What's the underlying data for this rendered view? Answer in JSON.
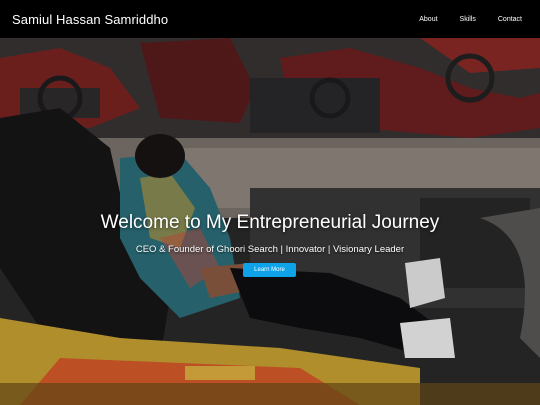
{
  "header": {
    "brand": "Samiul Hassan Samriddho",
    "nav": [
      {
        "label": "About"
      },
      {
        "label": "Skills"
      },
      {
        "label": "Contact"
      }
    ]
  },
  "hero": {
    "title": "Welcome to My Entrepreneurial Journey",
    "subtitle": "CEO & Founder of Ghoori Search | Innovator | Visionary Leader",
    "button_label": "Learn More",
    "button_color": "#0ea2e8"
  }
}
